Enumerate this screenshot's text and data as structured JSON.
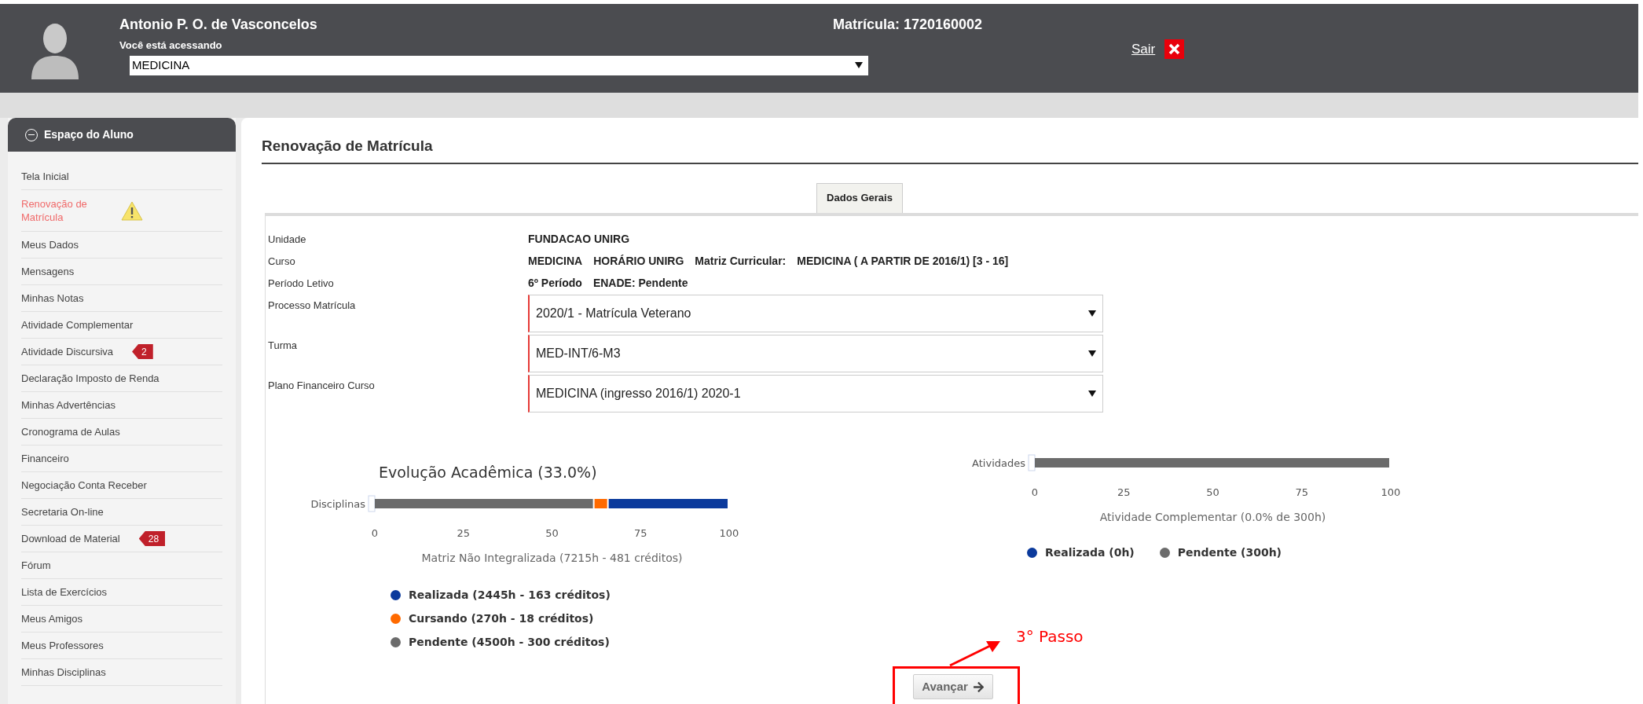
{
  "header": {
    "user_name": "Antonio P. O. de Vasconcelos",
    "access_label": "Você está acessando",
    "course_select": {
      "value": "MEDICINA"
    },
    "registration": "Matrícula: 1720160002",
    "logout": "Sair"
  },
  "sidebar": {
    "title": "Espaço do Aluno",
    "items": [
      {
        "label": "Tela Inicial",
        "selected": false,
        "warning": false
      },
      {
        "label": "Renovação de Matrícula",
        "selected": true,
        "warning": true
      },
      {
        "label": "Meus Dados",
        "selected": false,
        "warning": false
      },
      {
        "label": "Mensagens",
        "selected": false,
        "warning": false
      },
      {
        "label": "Minhas Notas",
        "selected": false,
        "warning": false
      },
      {
        "label": "Atividade Complementar",
        "selected": false,
        "warning": false
      },
      {
        "label": "Atividade Discursiva",
        "selected": false,
        "warning": false,
        "badge": "2"
      },
      {
        "label": "Declaração Imposto de Renda",
        "selected": false,
        "warning": false
      },
      {
        "label": "Minhas Advertências",
        "selected": false,
        "warning": false
      },
      {
        "label": "Cronograma de Aulas",
        "selected": false,
        "warning": false
      },
      {
        "label": "Financeiro",
        "selected": false,
        "warning": false
      },
      {
        "label": "Negociação Conta Receber",
        "selected": false,
        "warning": false
      },
      {
        "label": "Secretaria On-line",
        "selected": false,
        "warning": false
      },
      {
        "label": "Download de Material",
        "selected": false,
        "warning": false,
        "badge": "28"
      },
      {
        "label": "Fórum",
        "selected": false,
        "warning": false
      },
      {
        "label": "Lista de Exercícios",
        "selected": false,
        "warning": false
      },
      {
        "label": "Meus Amigos",
        "selected": false,
        "warning": false
      },
      {
        "label": "Meus Professores",
        "selected": false,
        "warning": false
      },
      {
        "label": "Minhas Disciplinas",
        "selected": false,
        "warning": false
      }
    ]
  },
  "page_title": "Renovação de Matrícula",
  "tabs": [
    {
      "label": "Dados Gerais",
      "selected": true
    }
  ],
  "fields": [
    {
      "kind": "text",
      "label": "Unidade",
      "values": [
        "FUNDACAO UNIRG"
      ]
    },
    {
      "kind": "text",
      "label": "Curso",
      "values": [
        "MEDICINA",
        "HORÁRIO UNIRG",
        "Matriz Curricular:",
        "MEDICINA ( A PARTIR DE 2016/1) [3 - 16]"
      ]
    },
    {
      "kind": "text",
      "label": "Período Letivo",
      "values": [
        "6º Período",
        "ENADE: Pendente"
      ]
    },
    {
      "kind": "select",
      "label": "Processo Matrícula",
      "values": [
        "2020/1 - Matrícula Veterano"
      ]
    },
    {
      "kind": "select",
      "label": "Turma",
      "values": [
        "MED-INT/6-M3"
      ]
    },
    {
      "kind": "select",
      "label": "Plano Financeiro Curso",
      "values": [
        "MEDICINA (ingresso 2016/1) 2020-1"
      ]
    }
  ],
  "charts": [
    {
      "chart_data": {
        "type": "bar",
        "orientation": "horizontal",
        "stacked": true,
        "title": "Evolução Acadêmica (33.0%)",
        "xlabel": "Matriz Não Integralizada (7215h - 481 créditos)",
        "categories": [
          "Disciplinas"
        ],
        "xlim": [
          0,
          100
        ],
        "xticks": [
          0,
          25,
          50,
          75,
          100
        ],
        "series": [
          {
            "name": "Realizada (2445h - 163 créditos)",
            "color": "#0b3a9c",
            "values": [
              34
            ]
          },
          {
            "name": "Cursando (270h - 18 créditos)",
            "color": "#ff6a00",
            "values": [
              4
            ]
          },
          {
            "name": "Pendente (4500h - 300 créditos)",
            "color": "#6b6b6b",
            "values": [
              62
            ]
          }
        ]
      },
      "legend_vertical": true
    },
    {
      "chart_data": {
        "type": "bar",
        "orientation": "horizontal",
        "stacked": true,
        "xlabel": "Atividade Complementar (0.0% de 300h)",
        "categories": [
          "Atividades"
        ],
        "xlim": [
          0,
          100
        ],
        "xticks": [
          0,
          25,
          50,
          75,
          100
        ],
        "series": [
          {
            "name": "Realizada (0h)",
            "color": "#0b3a9c",
            "values": [
              0
            ]
          },
          {
            "name": "Pendente (300h)",
            "color": "#6b6b6b",
            "values": [
              100
            ]
          }
        ]
      },
      "legend_vertical": false
    }
  ],
  "next_button": "Avançar",
  "annotation": {
    "text": "3° Passo"
  }
}
